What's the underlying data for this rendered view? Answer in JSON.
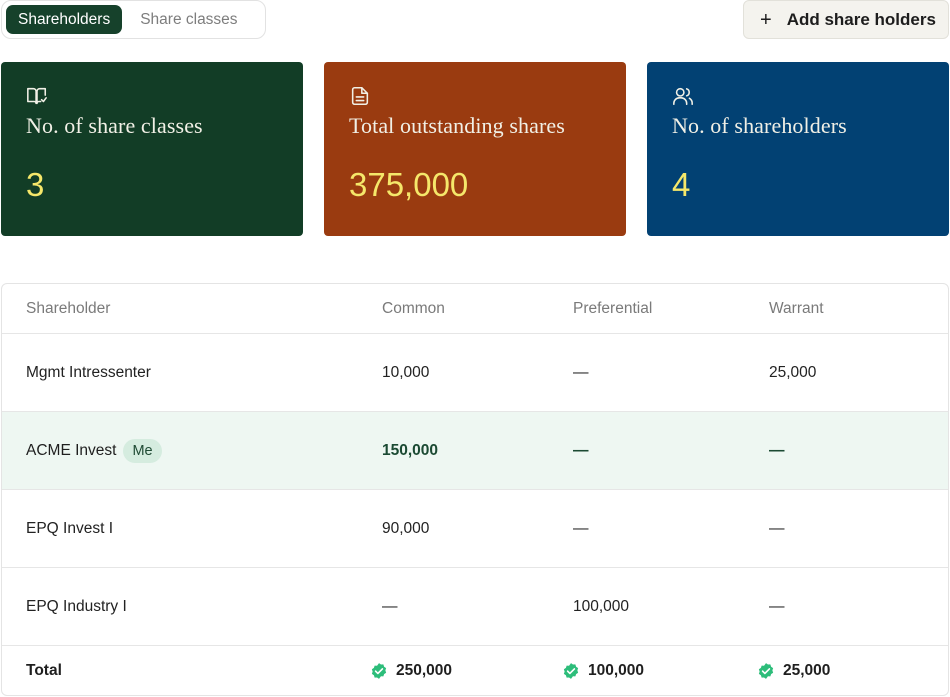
{
  "tabs": [
    {
      "label": "Shareholders",
      "active": true
    },
    {
      "label": "Share classes",
      "active": false
    }
  ],
  "actions": {
    "add_label": "Add share holders"
  },
  "cards": [
    {
      "icon": "book-icon",
      "label": "No. of share classes",
      "value": "3",
      "bg": "#123d26"
    },
    {
      "icon": "document-icon",
      "label": "Total outstanding shares",
      "value": "375,000",
      "bg": "#9a3b10"
    },
    {
      "icon": "users-icon",
      "label": "No. of shareholders",
      "value": "4",
      "bg": "#024173"
    }
  ],
  "table": {
    "headers": [
      "Shareholder",
      "Common",
      "Preferential",
      "Warrant"
    ],
    "rows": [
      {
        "name": "Mgmt Intressenter",
        "common": "10,000",
        "preferential": "—",
        "warrant": "25,000"
      },
      {
        "name": "ACME Invest",
        "badge": "Me",
        "common": "150,000",
        "preferential": "—",
        "warrant": "—",
        "highlight": true
      },
      {
        "name": "EPQ Invest I",
        "common": "90,000",
        "preferential": "—",
        "warrant": "—"
      },
      {
        "name": "EPQ Industry I",
        "common": "—",
        "preferential": "100,000",
        "warrant": "—"
      }
    ],
    "total": {
      "label": "Total",
      "common": "250,000",
      "preferential": "100,000",
      "warrant": "25,000"
    }
  },
  "colors": {
    "accent_green": "#16412b",
    "highlight_row": "#eef7f2",
    "check_green": "#2dbd7a",
    "card_value": "#f5e76a"
  }
}
